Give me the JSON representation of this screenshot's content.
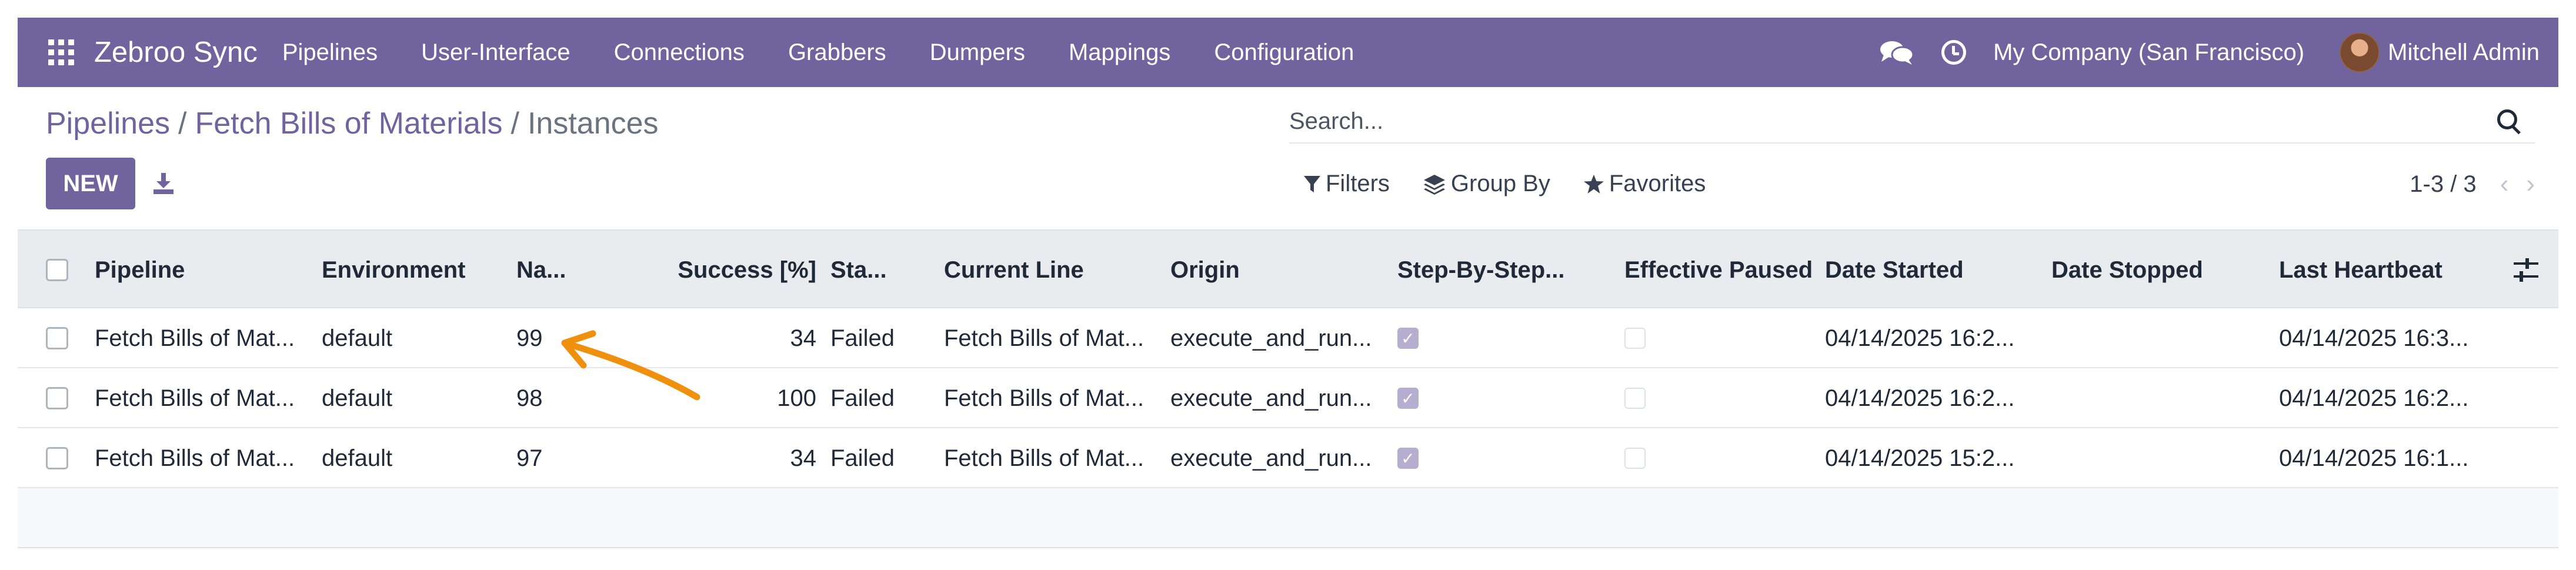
{
  "navbar": {
    "brand": "Zebroo Sync",
    "menu": [
      "Pipelines",
      "User-Interface",
      "Connections",
      "Grabbers",
      "Dumpers",
      "Mappings",
      "Configuration"
    ],
    "company": "My Company (San Francisco)",
    "user": "Mitchell Admin",
    "bg_color": "#71639e"
  },
  "breadcrumb": {
    "items": [
      "Pipelines",
      "Fetch Bills of Materials"
    ],
    "current": "Instances",
    "separator": "/"
  },
  "search": {
    "placeholder": "Search..."
  },
  "control": {
    "new_label": "NEW",
    "filters_label": "Filters",
    "group_by_label": "Group By",
    "favorites_label": "Favorites",
    "pager": "1-3 / 3"
  },
  "table": {
    "columns": [
      "Pipeline",
      "Environment",
      "Na...",
      "Success [%]",
      "Sta...",
      "Current Line",
      "Origin",
      "Step-By-Step...",
      "Effective Paused",
      "Date Started",
      "Date Stopped",
      "Last Heartbeat"
    ],
    "rows": [
      {
        "pipeline": "Fetch Bills of Mat...",
        "environment": "default",
        "name": "99",
        "success": "34",
        "state": "Failed",
        "current_line": "Fetch Bills of Mat...",
        "origin": "execute_and_run...",
        "step_by_step": true,
        "effective_paused": false,
        "date_started": "04/14/2025 16:2...",
        "date_stopped": "",
        "last_heartbeat": "04/14/2025 16:3..."
      },
      {
        "pipeline": "Fetch Bills of Mat...",
        "environment": "default",
        "name": "98",
        "success": "100",
        "state": "Failed",
        "current_line": "Fetch Bills of Mat...",
        "origin": "execute_and_run...",
        "step_by_step": true,
        "effective_paused": false,
        "date_started": "04/14/2025 16:2...",
        "date_stopped": "",
        "last_heartbeat": "04/14/2025 16:2..."
      },
      {
        "pipeline": "Fetch Bills of Mat...",
        "environment": "default",
        "name": "97",
        "success": "34",
        "state": "Failed",
        "current_line": "Fetch Bills of Mat...",
        "origin": "execute_and_run...",
        "step_by_step": true,
        "effective_paused": false,
        "date_started": "04/14/2025 15:2...",
        "date_stopped": "",
        "last_heartbeat": "04/14/2025 16:1..."
      }
    ]
  },
  "annotation": {
    "arrow_color": "#f0900f"
  }
}
